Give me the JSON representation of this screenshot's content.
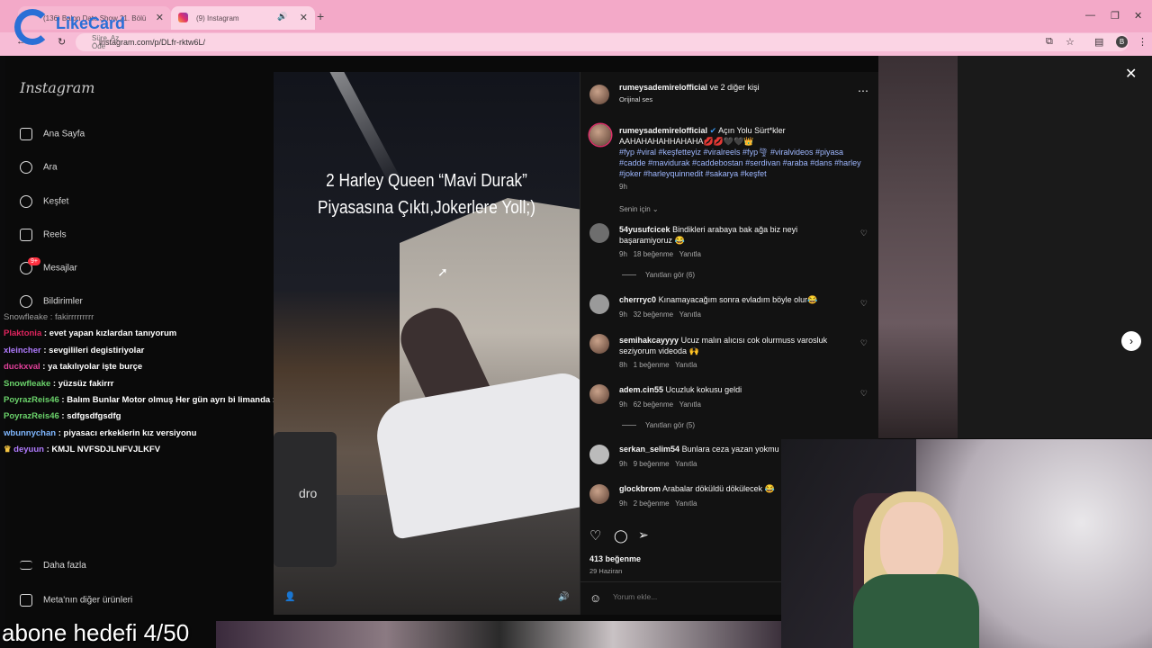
{
  "browser": {
    "tabs": [
      {
        "title": "(136) Balon Date Show 21. Bölü"
      },
      {
        "title": "(9) Instagram"
      }
    ],
    "url": "instagram.com/p/DLfr-rktw6L/",
    "profile_initial": "B"
  },
  "overlay_logo": {
    "name": "LikeCard",
    "sub": "Süre, Az Öde"
  },
  "sidebar": {
    "logo": "Instagram",
    "items": [
      {
        "label": "Ana Sayfa",
        "icon": "home-icon"
      },
      {
        "label": "Ara",
        "icon": "search-icon"
      },
      {
        "label": "Keşfet",
        "icon": "compass-icon"
      },
      {
        "label": "Reels",
        "icon": "reels-icon"
      },
      {
        "label": "Mesajlar",
        "icon": "messenger-icon",
        "badge": "9+"
      },
      {
        "label": "Bildirimler",
        "icon": "heart-icon"
      }
    ],
    "more": "Daha fazla",
    "meta": "Meta'nın diğer ürünleri"
  },
  "chat": [
    {
      "user": "Snowfleake",
      "msg": "fakirrrrrrrrr",
      "color": "#9b9b9b"
    },
    {
      "user": "Plaktonia",
      "msg": "evet yapan kızlardan tanıyorum",
      "color": "#e0245e"
    },
    {
      "user": "xleincher",
      "msg": "sevgilileri degistiriyolar",
      "color": "#b07bff"
    },
    {
      "user": "duckxval",
      "msg": "ya takılıyolar işte burçe",
      "color": "#e0409a"
    },
    {
      "user": "Snowfleake",
      "msg": "yüzsüz fakirrr",
      "color": "#6bd36b"
    },
    {
      "user": "PoyrazReis46",
      "msg": "Balım Bunlar Motor olmuş Her gün ayrı bi limanda :D",
      "color": "#6bd36b"
    },
    {
      "user": "PoyrazReis46",
      "msg": "sdfgsdfgsdfg",
      "color": "#6bd36b"
    },
    {
      "user": "wbunnychan",
      "msg": "piyasacı erkeklerin kız versiyonu",
      "color": "#7fb7ff"
    },
    {
      "user": "deyuun",
      "msg": "KMJL NVFSDJLNFVJLKFV",
      "color": "#b07bff"
    }
  ],
  "goal_text": "abone hedefi 4/50",
  "video": {
    "caption_line1": "2 Harley Queen “Mavi Durak”",
    "caption_line2": "Piyasasına Çıktı,Jokerlere Yoll;)",
    "bin_text": "dro"
  },
  "post": {
    "header_user": "rumeysademirelofficial",
    "header_rest": "ve 2 diğer kişi",
    "audio": "Orijinal ses",
    "caption_user": "rumeysademirelofficial",
    "caption_text": "Açın Yolu Sürt*kler AAHAHAHAHHAHAHA💋💋🖤🖤👑",
    "hashtags": "#fyp #viral #keşfetteyiz #viralreels #fyp🌪 #viralvideos #piyasa #cadde #mavidurak #caddebostan #serdivan #araba #dans #harley #joker #harleyquinnedit #sakarya #keşfet",
    "caption_time": "9h",
    "sort_label": "Senin için",
    "comments": [
      {
        "user": "54yusufcicek",
        "text": "Bindikleri arabaya bak ağa biz neyi başaramiyoruz 😂",
        "time": "9h",
        "likes": "18 beğenme",
        "reply": "Yanıtla",
        "view_replies": "Yanıtları gör (6)"
      },
      {
        "user": "cherrryc0",
        "text": "Kınamayacağım sonra evladım böyle olur😂",
        "time": "9h",
        "likes": "32 beğenme",
        "reply": "Yanıtla"
      },
      {
        "user": "semihakcayyyy",
        "text": "Ucuz malın alıcısı cok olurmuss varosluk seziyorum videoda 🙌",
        "time": "8h",
        "likes": "1 beğenme",
        "reply": "Yanıtla"
      },
      {
        "user": "adem.cin55",
        "text": "Ucuzluk kokusu geldi",
        "time": "9h",
        "likes": "62 beğenme",
        "reply": "Yanıtla",
        "view_replies": "Yanıtları gör (5)"
      },
      {
        "user": "serkan_selim54",
        "text": "Bunlara ceza yazan yokmu",
        "time": "9h",
        "likes": "9 beğenme",
        "reply": "Yanıtla"
      },
      {
        "user": "glockbrom",
        "text": "Arabalar döküldü dökülecek 😂",
        "time": "9h",
        "likes": "2 beğenme",
        "reply": "Yanıtla"
      }
    ],
    "likes": "413 beğenme",
    "date": "29 Haziran",
    "comment_placeholder": "Yorum ekle..."
  }
}
